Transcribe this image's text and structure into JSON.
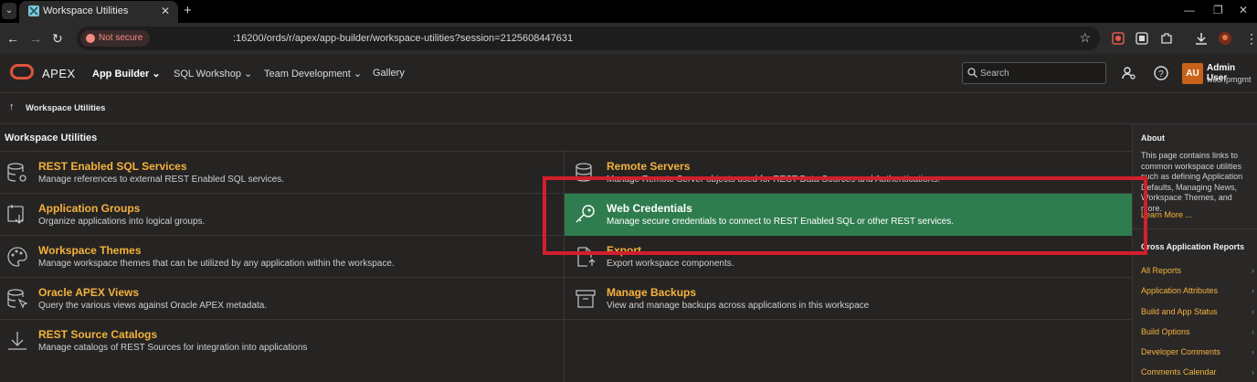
{
  "browser": {
    "tab_title": "Workspace Utilities",
    "not_secure": "Not secure",
    "url": ":16200/ords/r/apex/app-builder/workspace-utilities?session=2125608447631"
  },
  "apex": {
    "brand": "APEX",
    "menu": [
      "App Builder",
      "SQL Workshop",
      "Team Development",
      "Gallery"
    ],
    "search_placeholder": "Search",
    "user_initials": "AU",
    "user_name": "Admin User",
    "user_workspace": "wccrfpmgmt"
  },
  "breadcrumb": "Workspace Utilities",
  "region_title": "Workspace Utilities",
  "cards_left": [
    {
      "title": "REST Enabled SQL Services",
      "desc": "Manage references to external REST Enabled SQL services.",
      "icon": "database-gear-icon"
    },
    {
      "title": "Application Groups",
      "desc": "Organize applications into logical groups.",
      "icon": "app-group-icon"
    },
    {
      "title": "Workspace Themes",
      "desc": "Manage workspace themes that can be utilized by any application within the workspace.",
      "icon": "palette-icon"
    },
    {
      "title": "Oracle APEX Views",
      "desc": "Query the various views against Oracle APEX metadata.",
      "icon": "database-cursor-icon"
    },
    {
      "title": "REST Source Catalogs",
      "desc": "Manage catalogs of REST Sources for integration into applications",
      "icon": "download-icon"
    }
  ],
  "cards_right": [
    {
      "title": "Remote Servers",
      "desc": "Manage Remote Server objects used for REST Data Sources and Authentications.",
      "icon": "database-server-icon"
    },
    {
      "title": "Web Credentials",
      "desc": "Manage secure credentials to connect to REST Enabled SQL or other REST services.",
      "icon": "key-icon"
    },
    {
      "title": "Export ...",
      "desc": "Export workspace components.",
      "icon": "file-export-icon"
    },
    {
      "title": "Manage Backups",
      "desc": "View and manage backups across applications in this workspace",
      "icon": "archive-icon"
    }
  ],
  "sidebar": {
    "about_title": "About",
    "about_text": "This page contains links to common workspace utilities such as defining Application Defaults, Managing News, Workspace Themes, and more.",
    "learn_more": "Learn More ...",
    "reports_title": "Cross Application Reports",
    "reports": [
      "All Reports",
      "Application Attributes",
      "Build and App Status",
      "Build Options",
      "Developer Comments",
      "Comments Calendar"
    ]
  },
  "colors": {
    "accent": "#f4b23c",
    "highlight": "#2f7d4f",
    "annotation": "#d21f2b",
    "avatar": "#c8621a"
  }
}
